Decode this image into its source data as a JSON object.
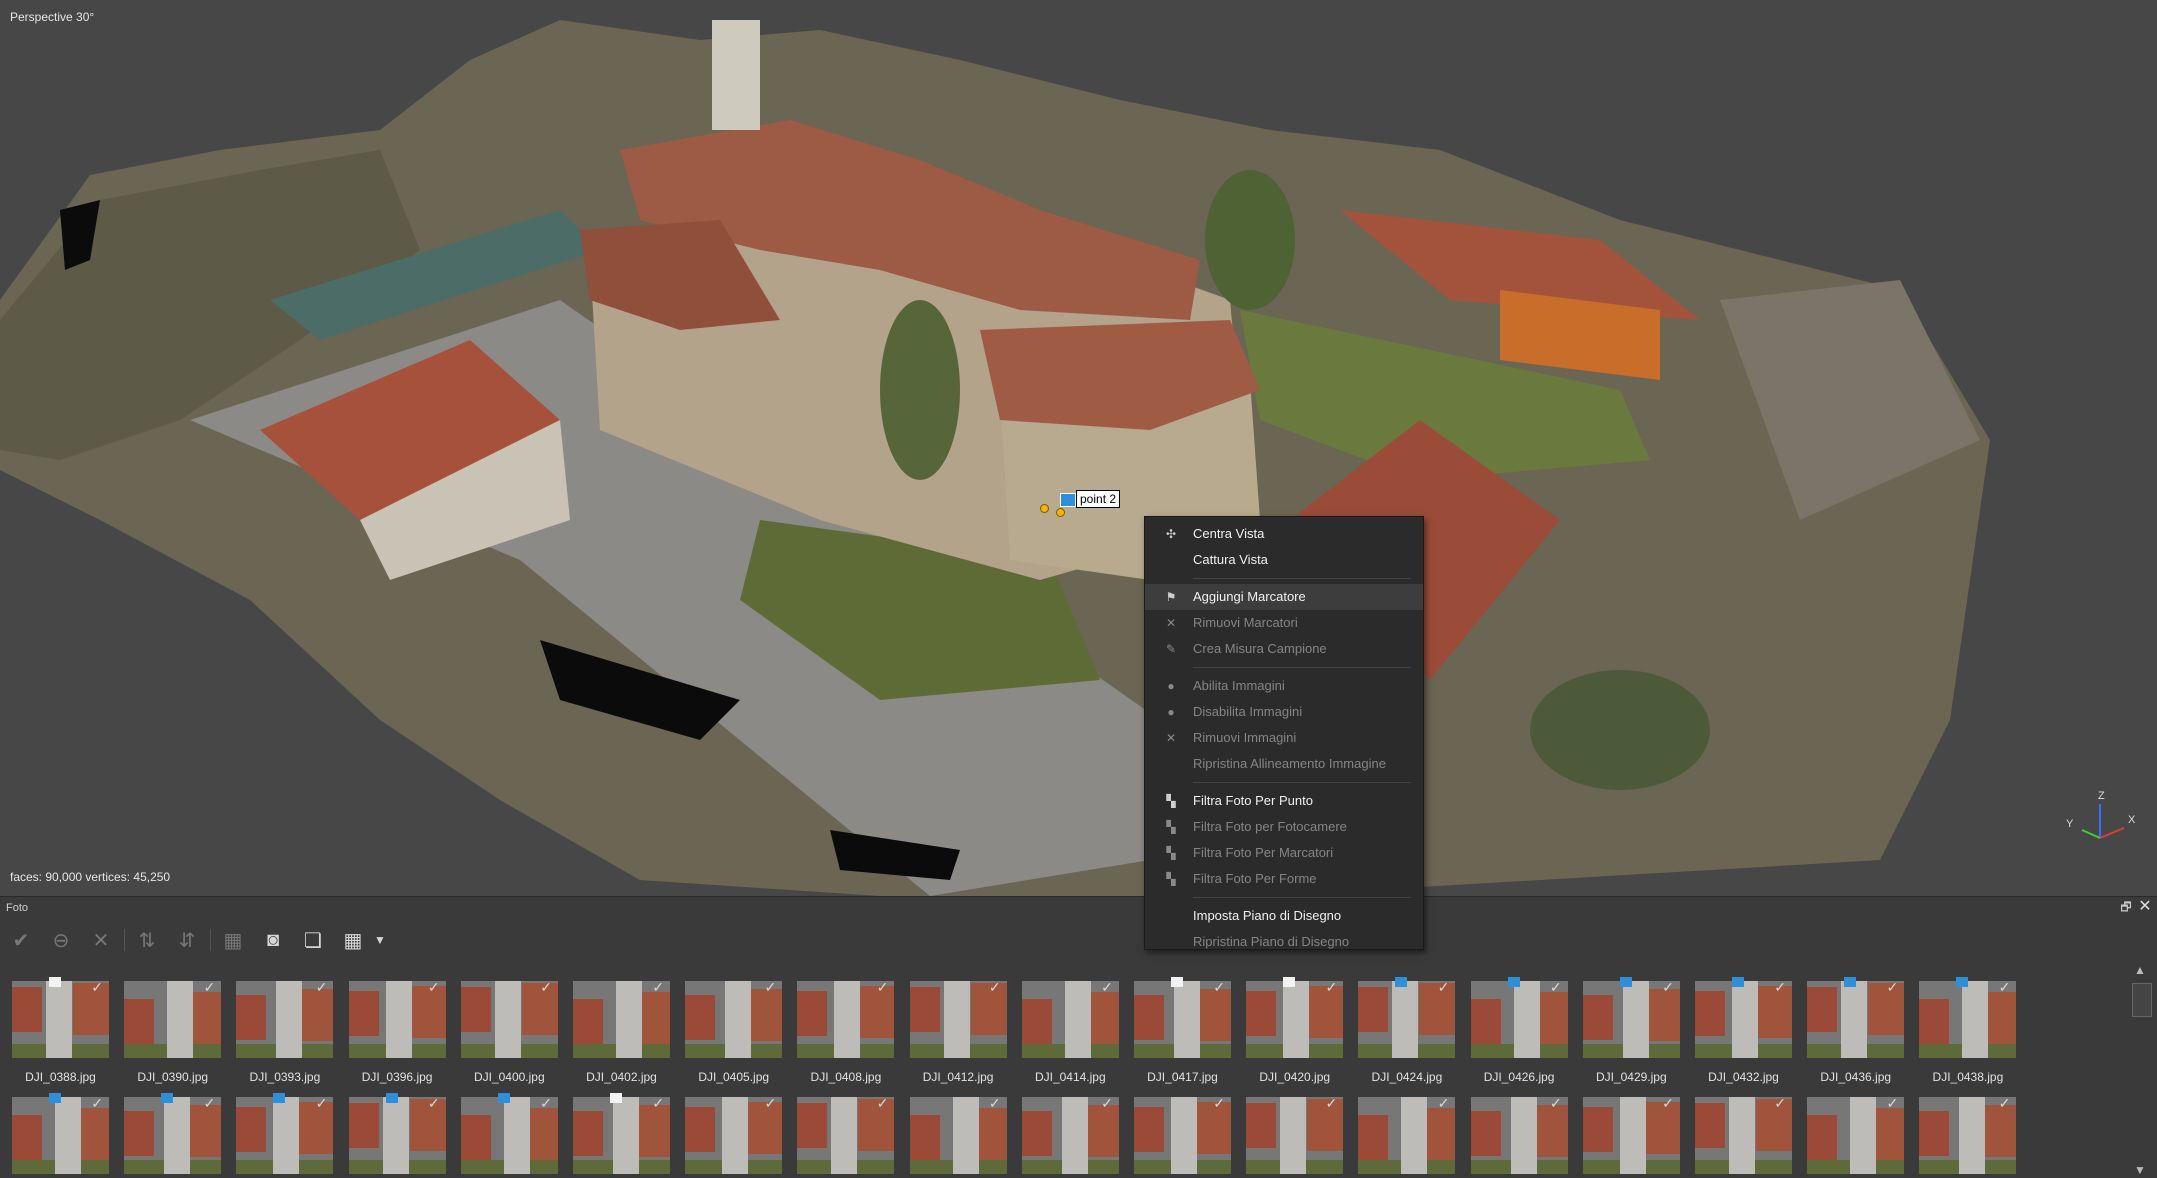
{
  "viewport": {
    "title": "Perspective 30°",
    "stats": "faces: 90,000 vertices: 45,250",
    "marker_label": "point 2",
    "axes": {
      "z": "Z",
      "y": "Y",
      "x": "X"
    }
  },
  "context_menu": {
    "items": [
      {
        "label": "Centra Vista",
        "icon": "crosshair-icon",
        "glyph": "✣",
        "enabled": true
      },
      {
        "label": "Cattura Vista",
        "icon": "",
        "glyph": "",
        "enabled": true
      },
      {
        "sep": true
      },
      {
        "label": "Aggiungi Marcatore",
        "icon": "marker-icon",
        "glyph": "⚑",
        "enabled": true,
        "highlight": true
      },
      {
        "label": "Rimuovi Marcatori",
        "icon": "remove-icon",
        "glyph": "✕",
        "enabled": false
      },
      {
        "label": "Crea Misura Campione",
        "icon": "measure-icon",
        "glyph": "✎",
        "enabled": false
      },
      {
        "sep": true
      },
      {
        "label": "Abilita Immagini",
        "icon": "enable-icon",
        "glyph": "●",
        "enabled": false
      },
      {
        "label": "Disabilita Immagini",
        "icon": "disable-icon",
        "glyph": "●",
        "enabled": false
      },
      {
        "label": "Rimuovi Immagini",
        "icon": "remove-icon",
        "glyph": "✕",
        "enabled": false
      },
      {
        "label": "Ripristina Allineamento Immagine",
        "icon": "",
        "glyph": "",
        "enabled": false
      },
      {
        "sep": true
      },
      {
        "label": "Filtra Foto Per Punto",
        "icon": "filter-icon",
        "glyph": "▚",
        "enabled": true
      },
      {
        "label": "Filtra Foto per Fotocamere",
        "icon": "filter-icon",
        "glyph": "▚",
        "enabled": false
      },
      {
        "label": "Filtra Foto Per Marcatori",
        "icon": "filter-icon",
        "glyph": "▚",
        "enabled": false
      },
      {
        "label": "Filtra Foto Per Forme",
        "icon": "filter-icon",
        "glyph": "▚",
        "enabled": false
      },
      {
        "sep": true
      },
      {
        "label": "Imposta Piano di Disegno",
        "icon": "",
        "glyph": "",
        "enabled": true
      },
      {
        "label": "Ripristina Piano di Disegno",
        "icon": "",
        "glyph": "",
        "enabled": false
      }
    ]
  },
  "photo_panel": {
    "title": "Foto",
    "restore_glyph": "🗗",
    "close_glyph": "✕",
    "toolbar": [
      {
        "name": "enable-button",
        "glyph": "✔",
        "active": false
      },
      {
        "name": "disable-button",
        "glyph": "⊖",
        "active": false
      },
      {
        "name": "delete-button",
        "glyph": "✕",
        "active": false
      },
      {
        "name": "align-selected-button",
        "glyph": "⇅",
        "active": false
      },
      {
        "name": "reset-alignment-button",
        "glyph": "⇵",
        "active": false
      },
      {
        "name": "group-button",
        "glyph": "▦",
        "active": false
      },
      {
        "name": "camera-view-button",
        "glyph": "◙",
        "active": true
      },
      {
        "name": "stack-view-button",
        "glyph": "❏",
        "active": true
      },
      {
        "name": "grid-view-button",
        "glyph": "▦",
        "active": true
      },
      {
        "name": "view-options-dropdown",
        "glyph": "▼",
        "active": true
      }
    ],
    "row1": [
      {
        "name": "DJI_0388.jpg",
        "flag": "white"
      },
      {
        "name": "DJI_0390.jpg",
        "flag": ""
      },
      {
        "name": "DJI_0393.jpg",
        "flag": ""
      },
      {
        "name": "DJI_0396.jpg",
        "flag": ""
      },
      {
        "name": "DJI_0400.jpg",
        "flag": ""
      },
      {
        "name": "DJI_0402.jpg",
        "flag": ""
      },
      {
        "name": "DJI_0405.jpg",
        "flag": ""
      },
      {
        "name": "DJI_0408.jpg",
        "flag": ""
      },
      {
        "name": "DJI_0412.jpg",
        "flag": ""
      },
      {
        "name": "DJI_0414.jpg",
        "flag": ""
      },
      {
        "name": "DJI_0417.jpg",
        "flag": "white"
      },
      {
        "name": "DJI_0420.jpg",
        "flag": "white"
      },
      {
        "name": "DJI_0424.jpg",
        "flag": "blue"
      },
      {
        "name": "DJI_0426.jpg",
        "flag": "blue"
      },
      {
        "name": "DJI_0429.jpg",
        "flag": "blue"
      },
      {
        "name": "DJI_0432.jpg",
        "flag": "blue"
      },
      {
        "name": "DJI_0436.jpg",
        "flag": "blue"
      },
      {
        "name": "DJI_0438.jpg",
        "flag": "blue"
      }
    ],
    "row2_flags": [
      "blue",
      "blue",
      "blue",
      "blue",
      "blue",
      "white",
      "",
      "",
      "",
      "",
      "",
      "",
      "",
      "",
      "",
      "",
      "",
      ""
    ],
    "check_glyph": "✓",
    "scroll": {
      "up": "▲",
      "down": "▼"
    },
    "colors": {
      "flag_blue": "#2e8fdb",
      "flag_white": "#f2f2f2"
    }
  }
}
